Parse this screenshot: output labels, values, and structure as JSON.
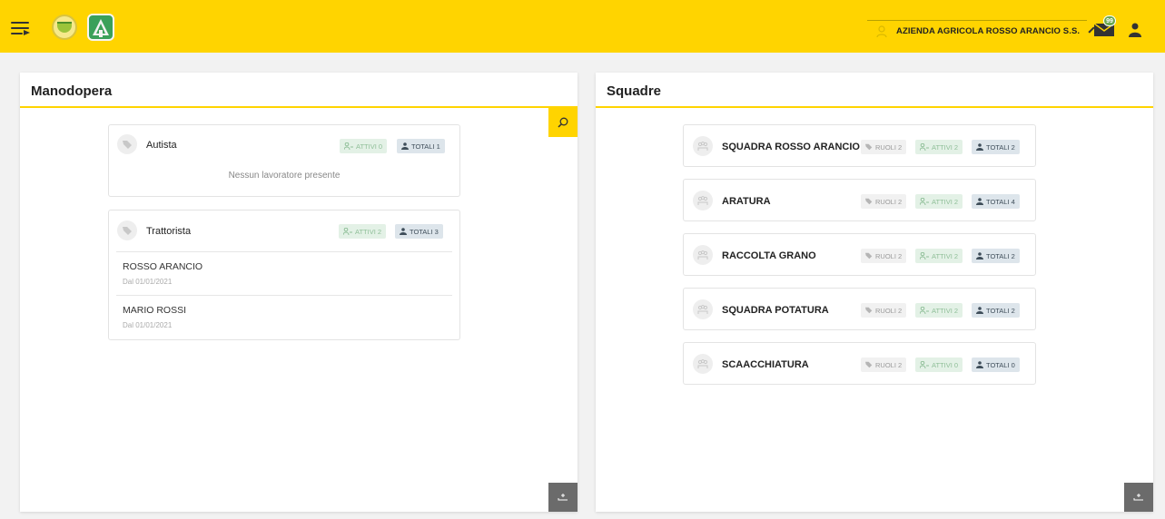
{
  "header": {
    "company_name": "AZIENDA AGRICOLA ROSSO ARANCIO S.S.",
    "messages_badge": "99",
    "brand_color": "#ffd400"
  },
  "manodopera": {
    "title": "Manodopera",
    "roles": [
      {
        "name": "Autista",
        "attivi_label": "ATTIVI 0",
        "totali_label": "TOTALI 1",
        "empty_text": "Nessun lavoratore presente",
        "workers": []
      },
      {
        "name": "Trattorista",
        "attivi_label": "ATTIVI 2",
        "totali_label": "TOTALI 3",
        "empty_text": "",
        "workers": [
          {
            "name": "ROSSO ARANCIO",
            "since": "Dal 01/01/2021"
          },
          {
            "name": "MARIO ROSSI",
            "since": "Dal 01/01/2021"
          }
        ]
      }
    ]
  },
  "squadre": {
    "title": "Squadre",
    "teams": [
      {
        "name": "SQUADRA ROSSO ARANCIO",
        "ruoli_label": "RUOLI 2",
        "attivi_label": "ATTIVI 2",
        "totali_label": "TOTALI 2"
      },
      {
        "name": "ARATURA",
        "ruoli_label": "RUOLI 2",
        "attivi_label": "ATTIVI 2",
        "totali_label": "TOTALI 4"
      },
      {
        "name": "RACCOLTA GRANO",
        "ruoli_label": "RUOLI 2",
        "attivi_label": "ATTIVI 2",
        "totali_label": "TOTALI 2"
      },
      {
        "name": "SQUADRA POTATURA",
        "ruoli_label": "RUOLI 2",
        "attivi_label": "ATTIVI 2",
        "totali_label": "TOTALI 2"
      },
      {
        "name": "SCAACCHIATURA",
        "ruoli_label": "RUOLI 2",
        "attivi_label": "ATTIVI 0",
        "totali_label": "TOTALI 0"
      }
    ]
  }
}
